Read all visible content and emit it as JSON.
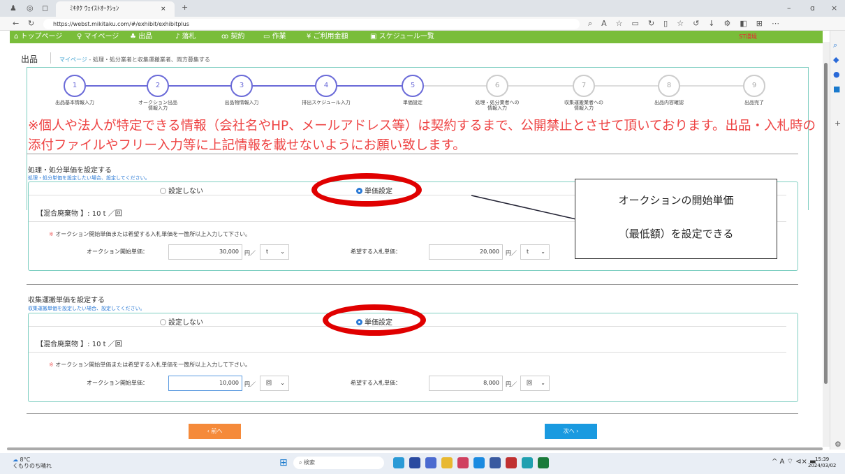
{
  "browser": {
    "tab_title": "ﾐｷﾀｸ ｳｪｲｽﾄｵｰｸｼｮﾝ",
    "url": "https://webst.mikitaku.com/#/exhibit/exhibitplus",
    "new_tab": "+",
    "min": "–",
    "restore": "ɑ",
    "close": "×"
  },
  "nav": {
    "items": [
      "⌂ トップページ",
      "♀ マイページ",
      "♣ 出品",
      "♪ 落札",
      "ꝏ 契約",
      "▭ 作業",
      "¥ ご利用金額",
      "▣ スケジュール一覧"
    ],
    "env": "ST環境"
  },
  "page": {
    "title": "出品",
    "breadcrumb": "マイページ",
    "breadcrumb_rest": " - 処理・処分業者と収集運搬業者、両方募集する"
  },
  "steps": [
    {
      "num": "1",
      "label": "出品基本情報入力"
    },
    {
      "num": "2",
      "label": "オークション出品\n情報入力"
    },
    {
      "num": "3",
      "label": "出品物情報入力"
    },
    {
      "num": "4",
      "label": "排出スケジュール入力"
    },
    {
      "num": "5",
      "label": "単価設定"
    },
    {
      "num": "6",
      "label": "処理・処分業者への\n情報入力"
    },
    {
      "num": "7",
      "label": "収集運搬業者への\n情報入力"
    },
    {
      "num": "8",
      "label": "出品内容確認"
    },
    {
      "num": "9",
      "label": "出品完了"
    }
  ],
  "warning": "※個人や法人が特定できる情報（会社名やHP、メールアドレス等）は契約するまで、公開禁止とさせて頂いております。出品・入札時の添付ファイルやフリー入力等に上記情報を載せないようにお願い致します。",
  "disposal": {
    "heading": "処理・処分単価を設定する",
    "sub": "処理・処分単価を設定したい場合、設定してください。",
    "opt_no": "設定しない",
    "opt_yes": "単価設定",
    "item": "【混合廃棄物 】: 10 t ／回",
    "mark": "※",
    "note": " オークション開始単価または希望する入札単価を一箇所以上入力して下さい。",
    "start_label": "オークション開始単価：",
    "start_value": "30,000",
    "unit": "円／",
    "start_sel": "t",
    "hope_label": "希望する入札単価：",
    "hope_value": "20,000",
    "hope_sel": "t"
  },
  "collection": {
    "heading": "収集運搬単価を設定する",
    "sub": "収集運搬単価を設定したい場合、設定してください。",
    "opt_no": "設定しない",
    "opt_yes": "単価設定",
    "item": "【混合廃棄物 】: 10 t ／回",
    "mark": "※",
    "note": " オークション開始単価または希望する入札単価を一箇所以上入力して下さい。",
    "start_label": "オークション開始単価：",
    "start_value": "10,000",
    "unit": "円／",
    "start_sel": "回",
    "hope_label": "希望する入札単価：",
    "hope_value": "8,000",
    "hope_sel": "回"
  },
  "callout": {
    "line1": "オークションの開始単価",
    "line2": "（最低額）を設定できる"
  },
  "buttons": {
    "prev": "‹ 前へ",
    "next": "次へ ›"
  },
  "taskbar": {
    "weather_temp": "8°C",
    "weather_text": "くもりのち晴れ",
    "search": "検索",
    "time": "15:39",
    "date": "2024/03/02",
    "tray": "^ A ⌔ ⊲× ▬"
  },
  "colors": {
    "nav": "#79bd3a",
    "accent": "#6a6ad8",
    "warning": "#ee4444",
    "prev_btn": "#f58a3a",
    "next_btn": "#1a9ae0",
    "highlight": "#e00000"
  }
}
